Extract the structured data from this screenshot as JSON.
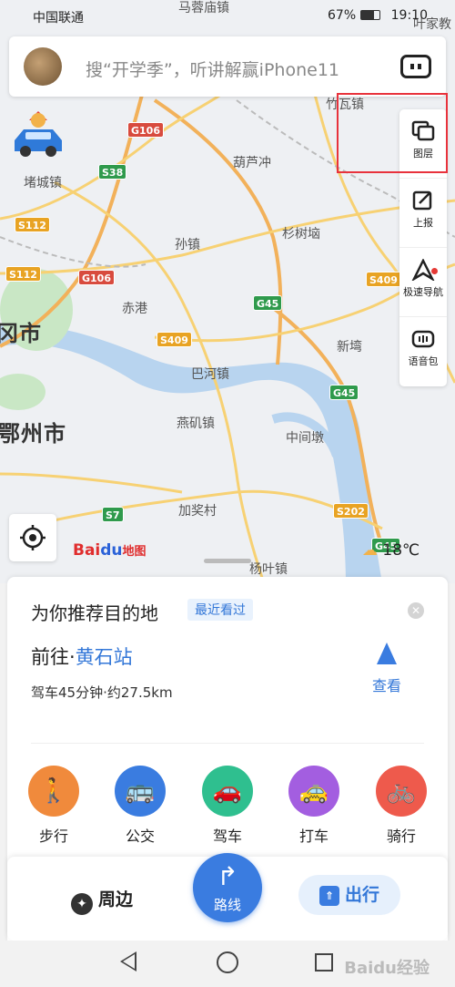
{
  "status_bar": {
    "carrier": "中国联通",
    "battery": "67%",
    "time": "19:10"
  },
  "search": {
    "placeholder": "搜“开学季”，听讲解赢iPhone11"
  },
  "tools": [
    {
      "label": "图层",
      "icon": "layers-icon"
    },
    {
      "label": "上报",
      "icon": "report-icon"
    },
    {
      "label": "极速导航",
      "icon": "fast-navigation-icon"
    },
    {
      "label": "语音包",
      "icon": "voice-pack-icon"
    }
  ],
  "map": {
    "places": [
      "马蓉庙镇",
      "竹瓦镇",
      "叶家教",
      "堵城镇",
      "葫芦冲",
      "孙镇",
      "杉树垴",
      "赤港",
      "新塆",
      "巴河镇",
      "燕矶镇",
      "中间墩",
      "加奖村",
      "杨叶镇"
    ],
    "cities": [
      "冈市",
      "鄂州市"
    ],
    "road_shields": [
      "G106",
      "S38",
      "S112",
      "S112",
      "G106",
      "G45",
      "S409",
      "S409",
      "G45",
      "S7",
      "S202",
      "G45"
    ],
    "logo_text": "Bai",
    "logo_du": "du",
    "logo_suffix": "地图",
    "weather": "18℃"
  },
  "recommend": {
    "title": "为你推荐目的地",
    "tag": "最近看过",
    "goto_prefix": "前往·",
    "destination": "黄石站",
    "drive_info": "驾车45分钟·约27.5km",
    "view_label": "查看"
  },
  "modes": [
    {
      "label": "步行",
      "icon": "walk-icon",
      "color": "#f08a3c"
    },
    {
      "label": "公交",
      "icon": "bus-icon",
      "color": "#3a7ce0"
    },
    {
      "label": "驾车",
      "icon": "car-icon",
      "color": "#2fbf8f"
    },
    {
      "label": "打车",
      "icon": "taxi-icon",
      "color": "#a35ee0"
    },
    {
      "label": "骑行",
      "icon": "bike-icon",
      "color": "#ee5a4c"
    }
  ],
  "bottom_nav": {
    "nearby": "周边",
    "route": "路线",
    "travel": "出行"
  },
  "watermark": "Baidu经验"
}
